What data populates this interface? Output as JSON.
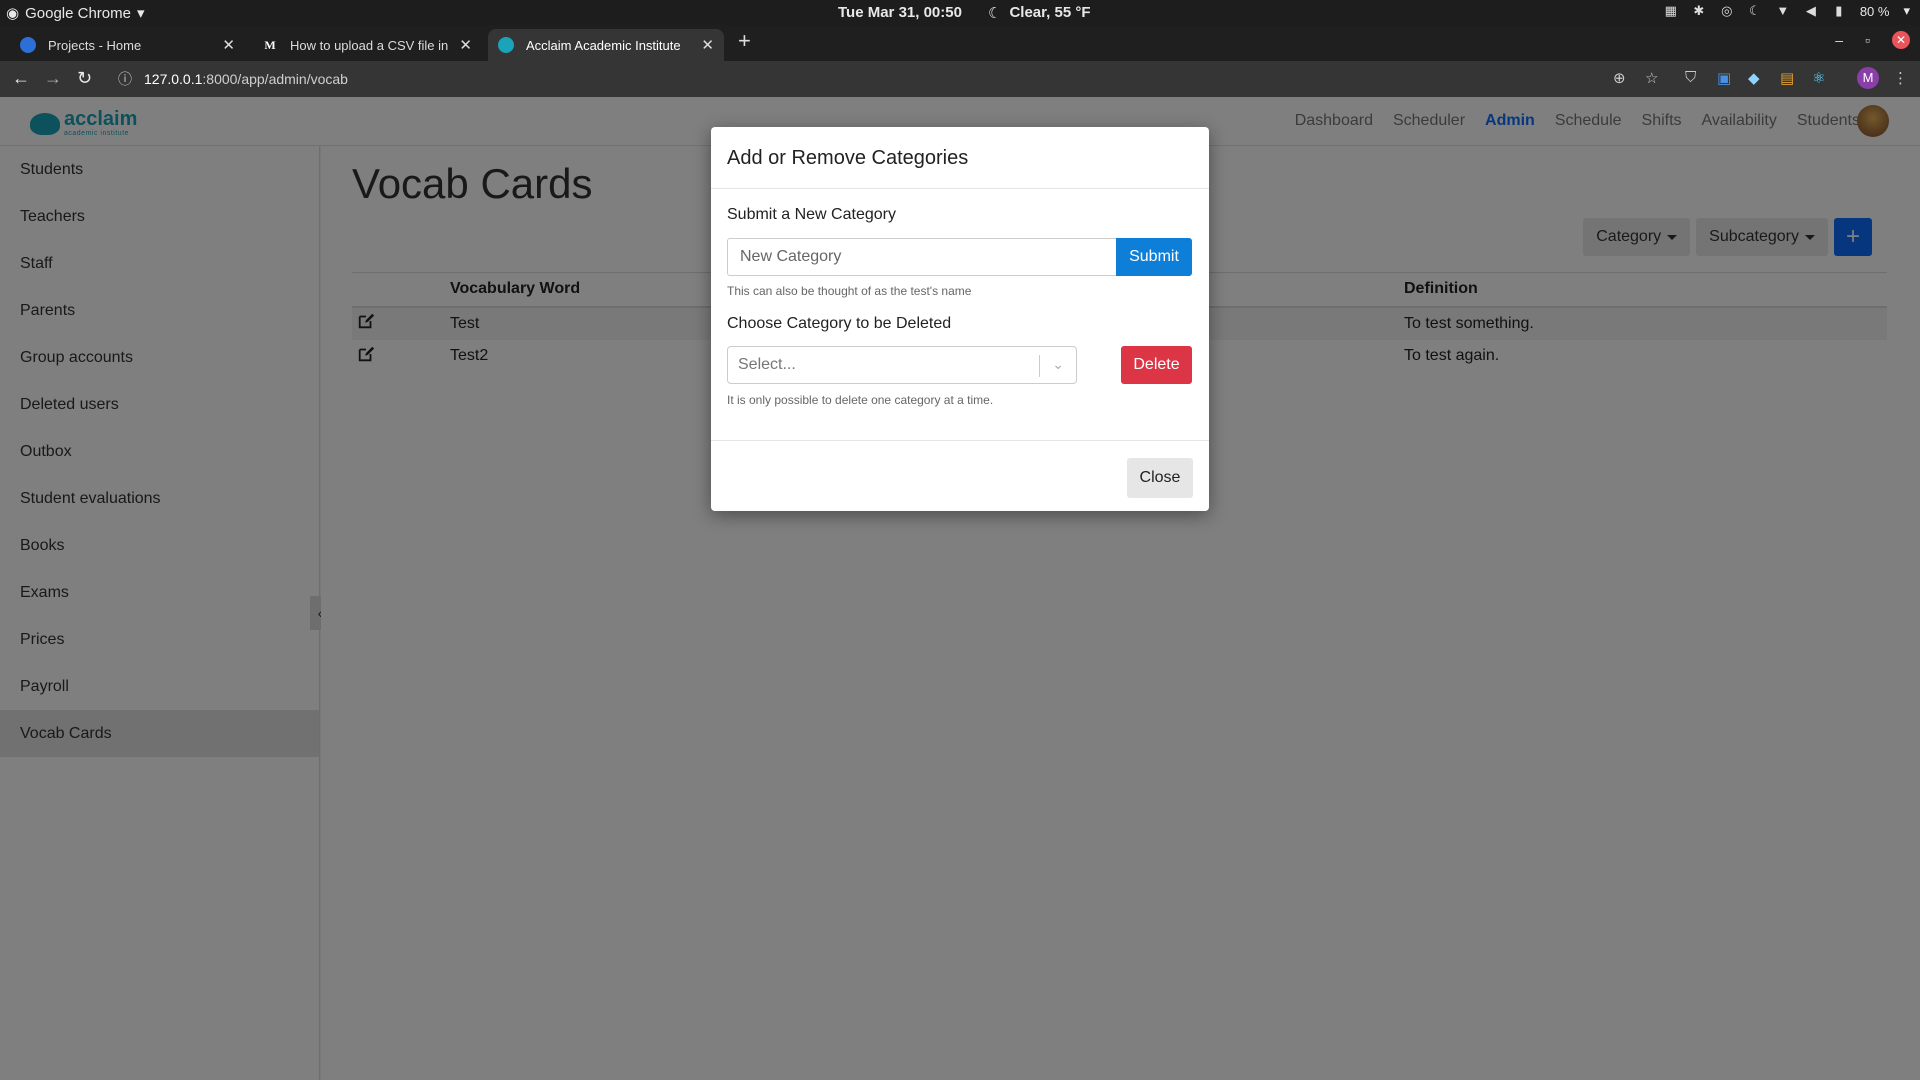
{
  "os": {
    "app_name": "Google Chrome",
    "clock": "Tue Mar 31, 00:50",
    "weather": "Clear, 55 °F",
    "battery": "80 %"
  },
  "browser": {
    "tabs": [
      {
        "title": "Projects - Home",
        "icon": "projects-icon",
        "icon_color": "#2d6fd6"
      },
      {
        "title": "How to upload a CSV file in D",
        "icon": "medium-icon",
        "icon_color": "#ffffff"
      },
      {
        "title": "Acclaim Academic Institute",
        "icon": "acclaim-icon",
        "icon_color": "#1aa3b9"
      }
    ],
    "url_host": "127.0.0.1",
    "url_path": ":8000/app/admin/vocab",
    "profile_initial": "M"
  },
  "app": {
    "logo_text": "acclaim",
    "logo_sub": "academic institute",
    "nav": [
      "Dashboard",
      "Scheduler",
      "Admin",
      "Schedule",
      "Shifts",
      "Availability",
      "Students"
    ],
    "active_nav": "Admin",
    "sidebar": [
      "Students",
      "Teachers",
      "Staff",
      "Parents",
      "Group accounts",
      "Deleted users",
      "Outbox",
      "Student evaluations",
      "Books",
      "Exams",
      "Prices",
      "Payroll",
      "Vocab Cards"
    ],
    "active_sidebar": "Vocab Cards"
  },
  "page": {
    "title": "Vocab Cards",
    "category_label": "Category",
    "subcategory_label": "Subcategory",
    "add_label": "+",
    "table": {
      "headers": [
        "",
        "Vocabulary Word",
        "Definition"
      ],
      "rows": [
        {
          "word": "Test",
          "definition": "To test something."
        },
        {
          "word": "Test2",
          "definition": "To test again."
        }
      ]
    }
  },
  "modal": {
    "title": "Add or Remove Categories",
    "new_label": "Submit a New Category",
    "new_placeholder": "New Category",
    "submit_label": "Submit",
    "new_help": "This can also be thought of as the test's name",
    "delete_label_heading": "Choose Category to be Deleted",
    "select_placeholder": "Select...",
    "delete_label": "Delete",
    "delete_help": "It is only possible to delete one category at a time.",
    "close_label": "Close"
  },
  "colors": {
    "primary": "#0d6efd",
    "danger": "#dc3545",
    "brand": "#1aa3b9"
  }
}
